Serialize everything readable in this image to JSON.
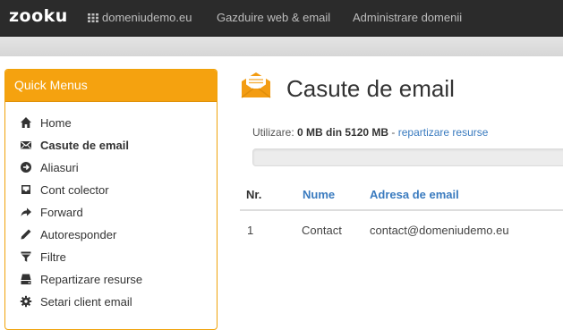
{
  "navbar": {
    "logo": "zooku",
    "items": [
      {
        "label": "domeniudemo.eu",
        "icon": "grid-icon"
      },
      {
        "label": "Gazduire web & email"
      },
      {
        "label": "Administrare domenii"
      }
    ]
  },
  "sidebar": {
    "title": "Quick Menus",
    "accent_color": "#f5a20f",
    "items": [
      {
        "label": "Home",
        "icon": "home-icon"
      },
      {
        "label": "Casute de email",
        "icon": "envelope-icon",
        "active": true
      },
      {
        "label": "Aliasuri",
        "icon": "arrow-circle-icon"
      },
      {
        "label": "Cont colector",
        "icon": "inbox-icon"
      },
      {
        "label": "Forward",
        "icon": "forward-arrow-icon"
      },
      {
        "label": "Autoresponder",
        "icon": "pencil-icon"
      },
      {
        "label": "Filtre",
        "icon": "filter-icon"
      },
      {
        "label": "Repartizare resurse",
        "icon": "drive-icon"
      },
      {
        "label": "Setari client email",
        "icon": "gear-icon"
      }
    ]
  },
  "main": {
    "title": "Casute de email",
    "title_icon": "open-envelope-icon",
    "usage": {
      "prefix": "Utilizare:",
      "value": "0 MB din 5120 MB",
      "separator": " - ",
      "link": "repartizare resurse",
      "percent": 0
    },
    "table": {
      "headers": [
        "Nr.",
        "Nume",
        "Adresa de email"
      ],
      "rows": [
        [
          "1",
          "Contact",
          "contact@domeniudemo.eu"
        ]
      ]
    }
  },
  "colors": {
    "navbar_bg": "#2b2b2b",
    "link": "#3a7bbf",
    "accent": "#f5a20f"
  }
}
